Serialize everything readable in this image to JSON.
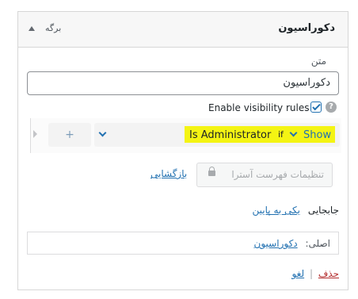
{
  "panel": {
    "title": "دکوراسیون",
    "item_type": "برگه"
  },
  "text_field": {
    "label": "متن",
    "value": "دکوراسیون"
  },
  "visibility": {
    "label": "Enable visibility rules",
    "checked": true,
    "help_glyph": "?"
  },
  "rule": {
    "add_glyph": "+",
    "condition": "Is Administrator",
    "connector": "if",
    "action": "Show",
    "highlight_color": "#f4f413"
  },
  "astra": {
    "button_label": "تنظیمات فهرست آسترا",
    "reset_label": "بازگشایی"
  },
  "move": {
    "label": "جابجایی",
    "link": "یکی به پایین"
  },
  "original": {
    "label": "اصلی:",
    "link": "دکوراسیون"
  },
  "actions": {
    "delete": "حذف",
    "separator": "|",
    "cancel": "لغو"
  },
  "colors": {
    "accent": "#2271b1",
    "danger": "#b32d2e"
  }
}
